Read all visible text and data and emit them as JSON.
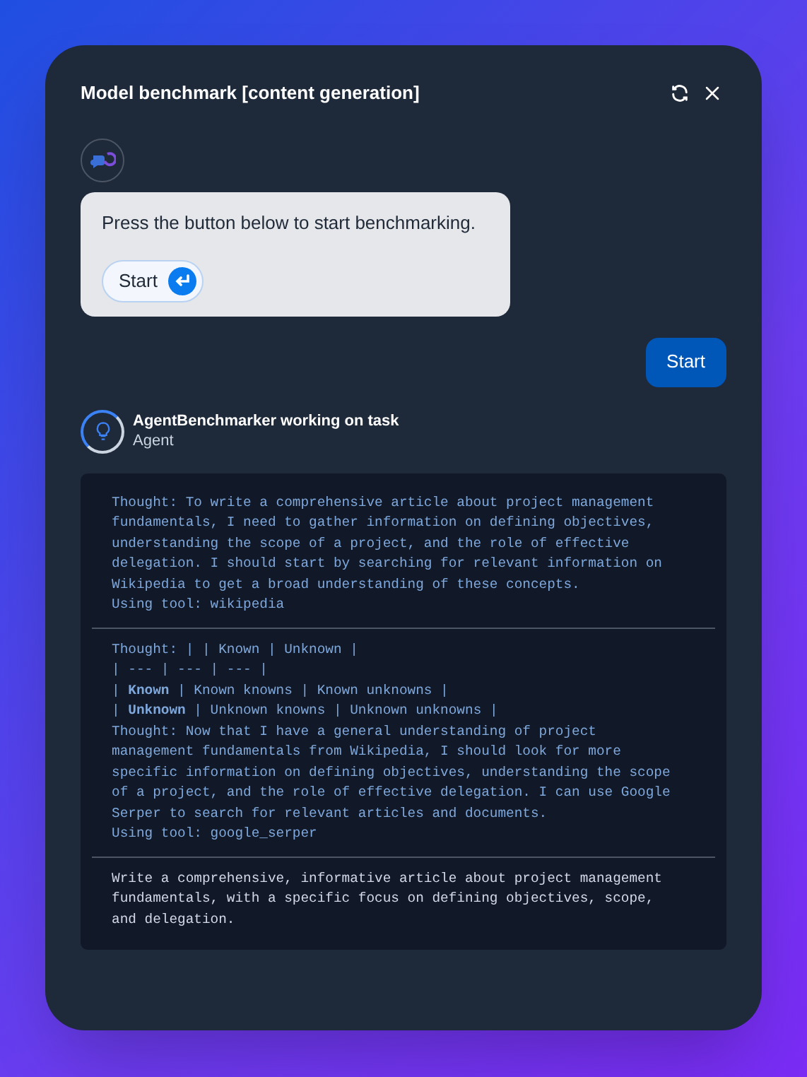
{
  "window": {
    "title": "Model benchmark [content generation]"
  },
  "bot_message": {
    "text": "Press the button below to start benchmarking.",
    "button": "Start"
  },
  "user_message": {
    "text": "Start"
  },
  "agent": {
    "name": "AgentBenchmarker working on task",
    "role": "Agent"
  },
  "log": [
    {
      "kind": "thought",
      "lines": [
        "Thought: To write a comprehensive article about project management",
        "fundamentals, I need to gather information on defining objectives,",
        "understanding the scope of a project, and the role of effective",
        "delegation. I should start by searching for relevant information on",
        "Wikipedia to get a broad understanding of these concepts.",
        "Using tool: wikipedia"
      ]
    },
    {
      "kind": "thought",
      "lines": [
        "Thought: | | Known | Unknown |",
        "| --- | --- | --- |",
        "| **Known** | Known knowns | Known unknowns |",
        "| **Unknown** | Unknown knowns | Unknown unknowns |",
        "Thought: Now that I have a general understanding of project",
        "management fundamentals from Wikipedia, I should look for more",
        "specific information on defining objectives, understanding the scope",
        "of a project, and the role of effective delegation. I can use Google",
        "Serper to search for relevant articles and documents.",
        "Using tool: google_serper"
      ]
    },
    {
      "kind": "task",
      "lines": [
        "Write a comprehensive, informative article about project management",
        "fundamentals, with a specific focus on defining objectives, scope,",
        "and delegation."
      ]
    }
  ]
}
